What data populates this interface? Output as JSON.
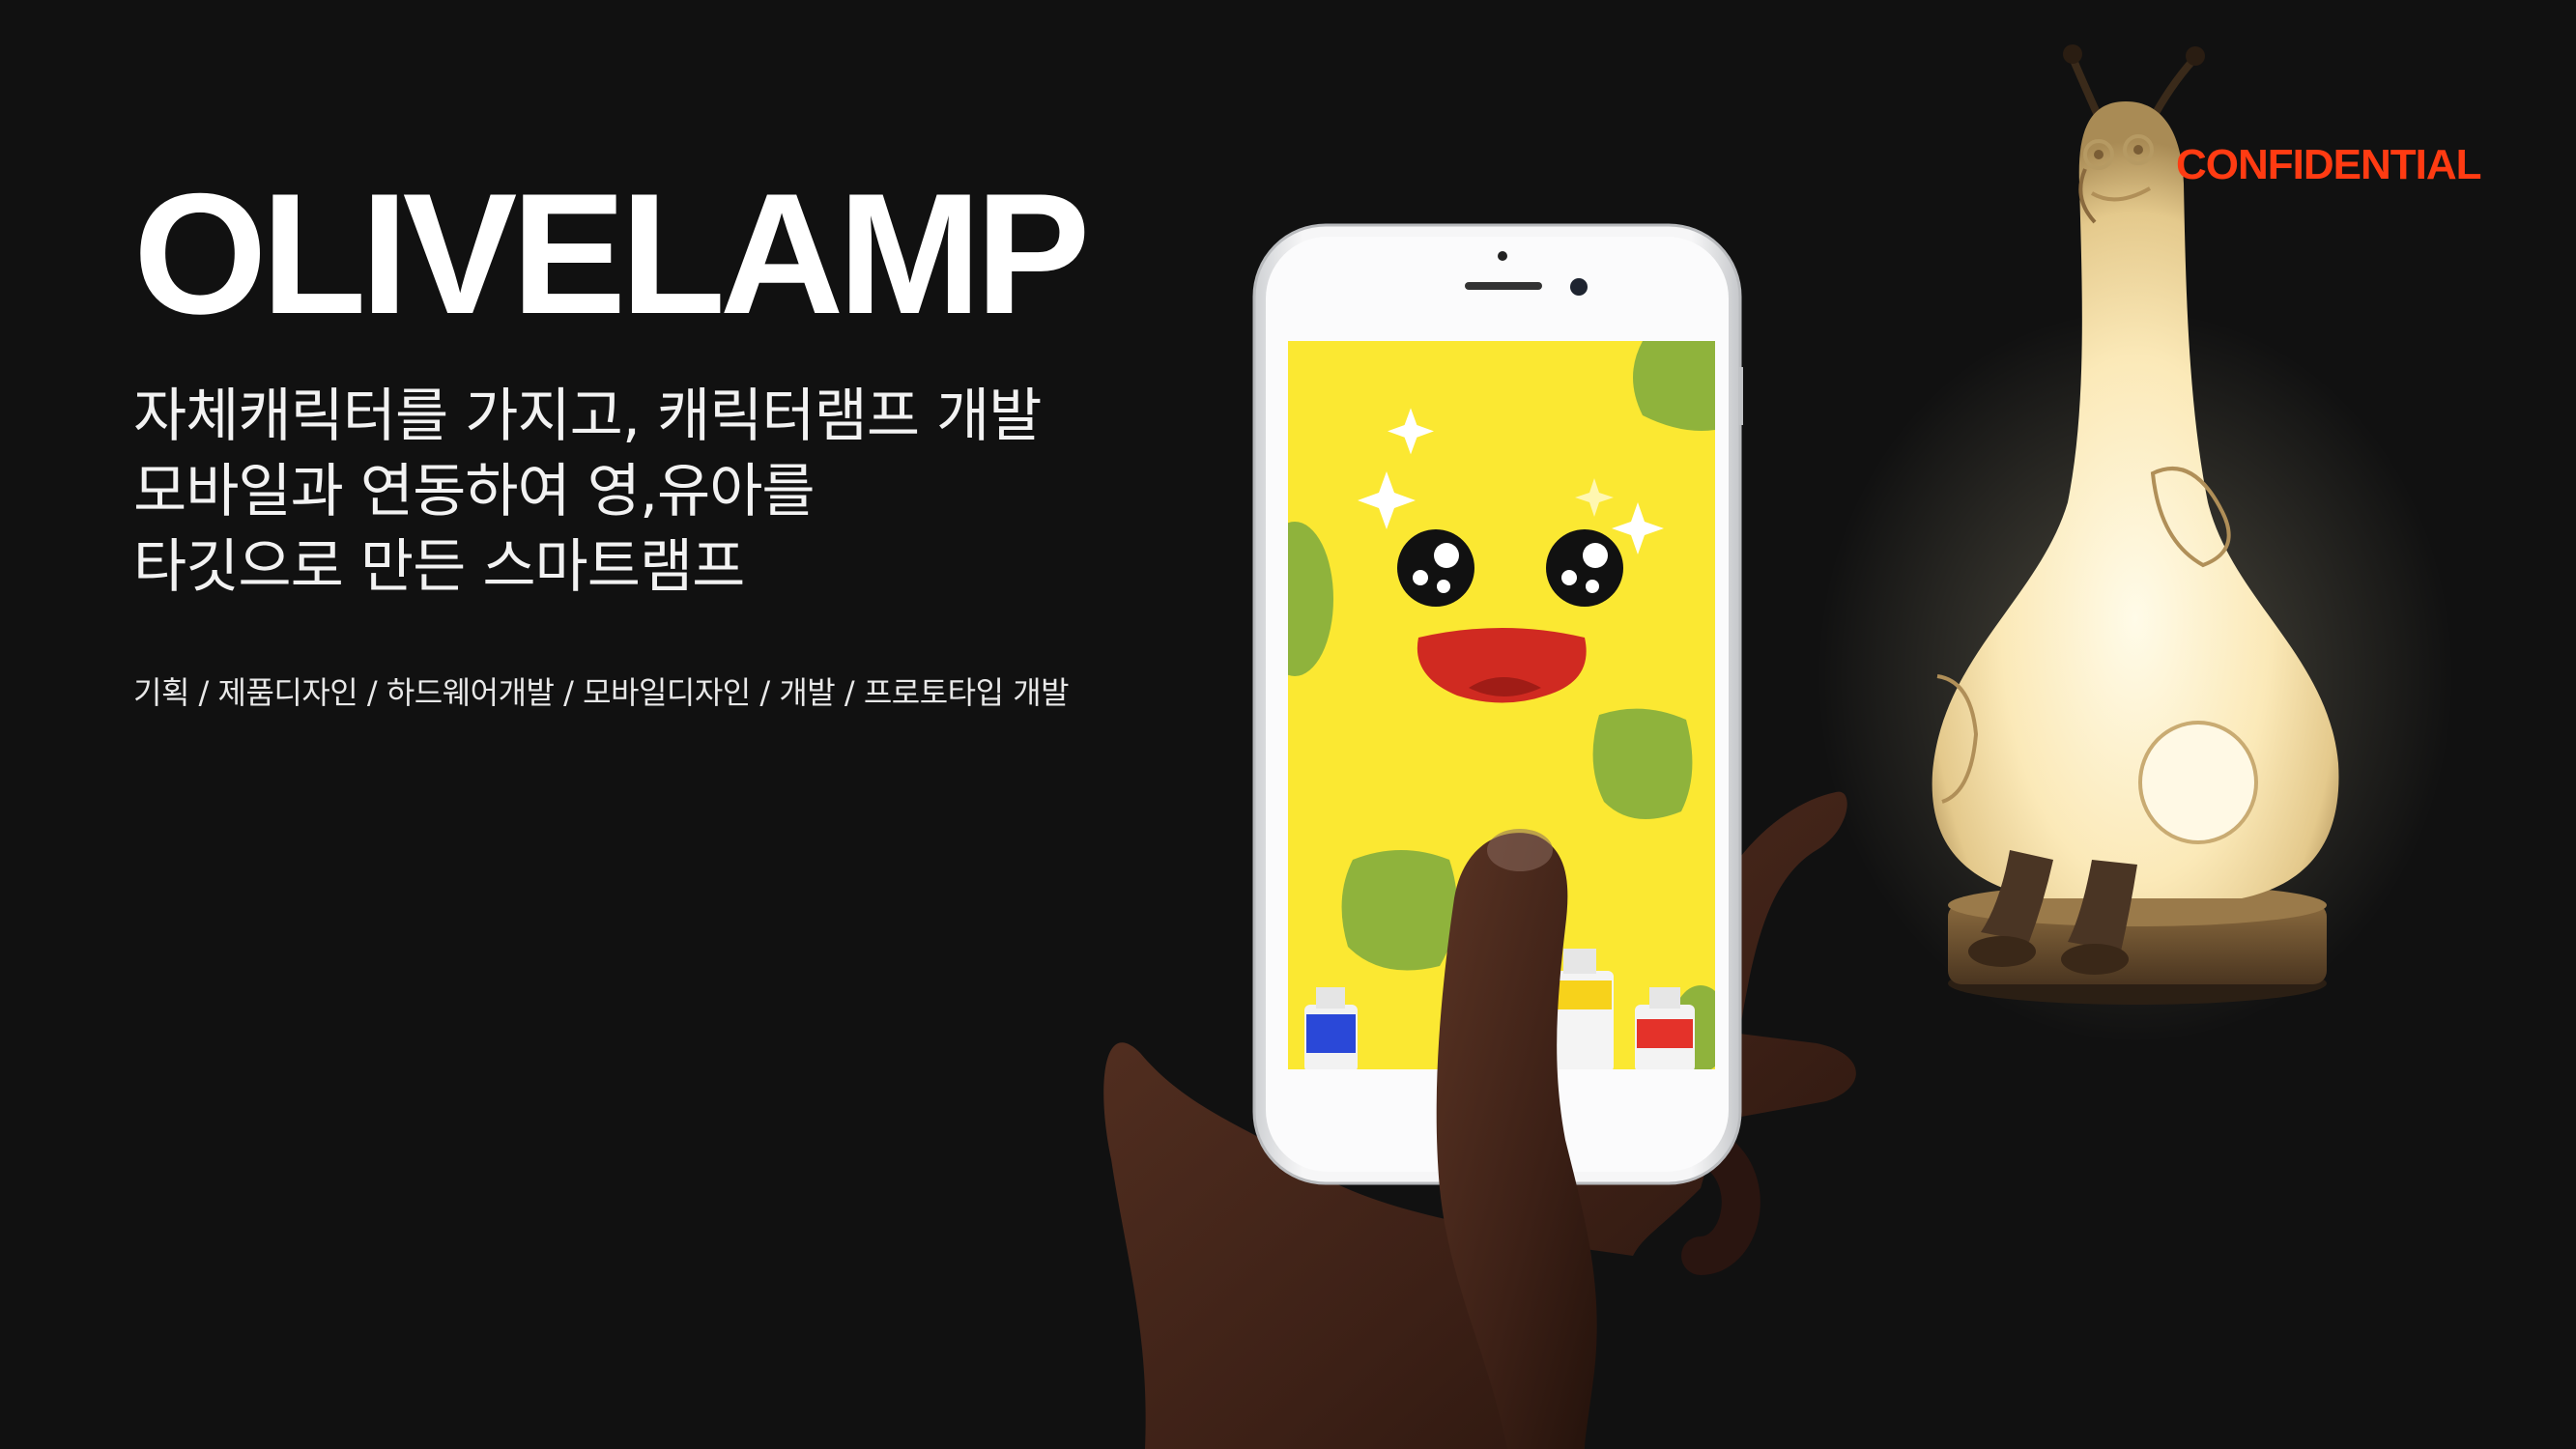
{
  "title": "OLIVELAMP",
  "description": [
    "자체캐릭터를 가지고,  캐릭터램프 개발",
    "모바일과 연동하여 영,유아를",
    "타깃으로 만든 스마트램프"
  ],
  "roles": "기획 / 제품디자인 / 하드웨어개발 / 모바일디자인 / 개발 / 프로토타입 개발",
  "badge": "CONFIDENTIAL",
  "colors": {
    "background": "#111111",
    "badge": "#ff3b12",
    "screen": "#fbe832",
    "spot": "#8fb33c",
    "lamp_glow": "#fff5d6",
    "mouth": "#d02a21"
  },
  "icons": [
    "phone-illustration",
    "hand-illustration",
    "lamp-illustration"
  ]
}
